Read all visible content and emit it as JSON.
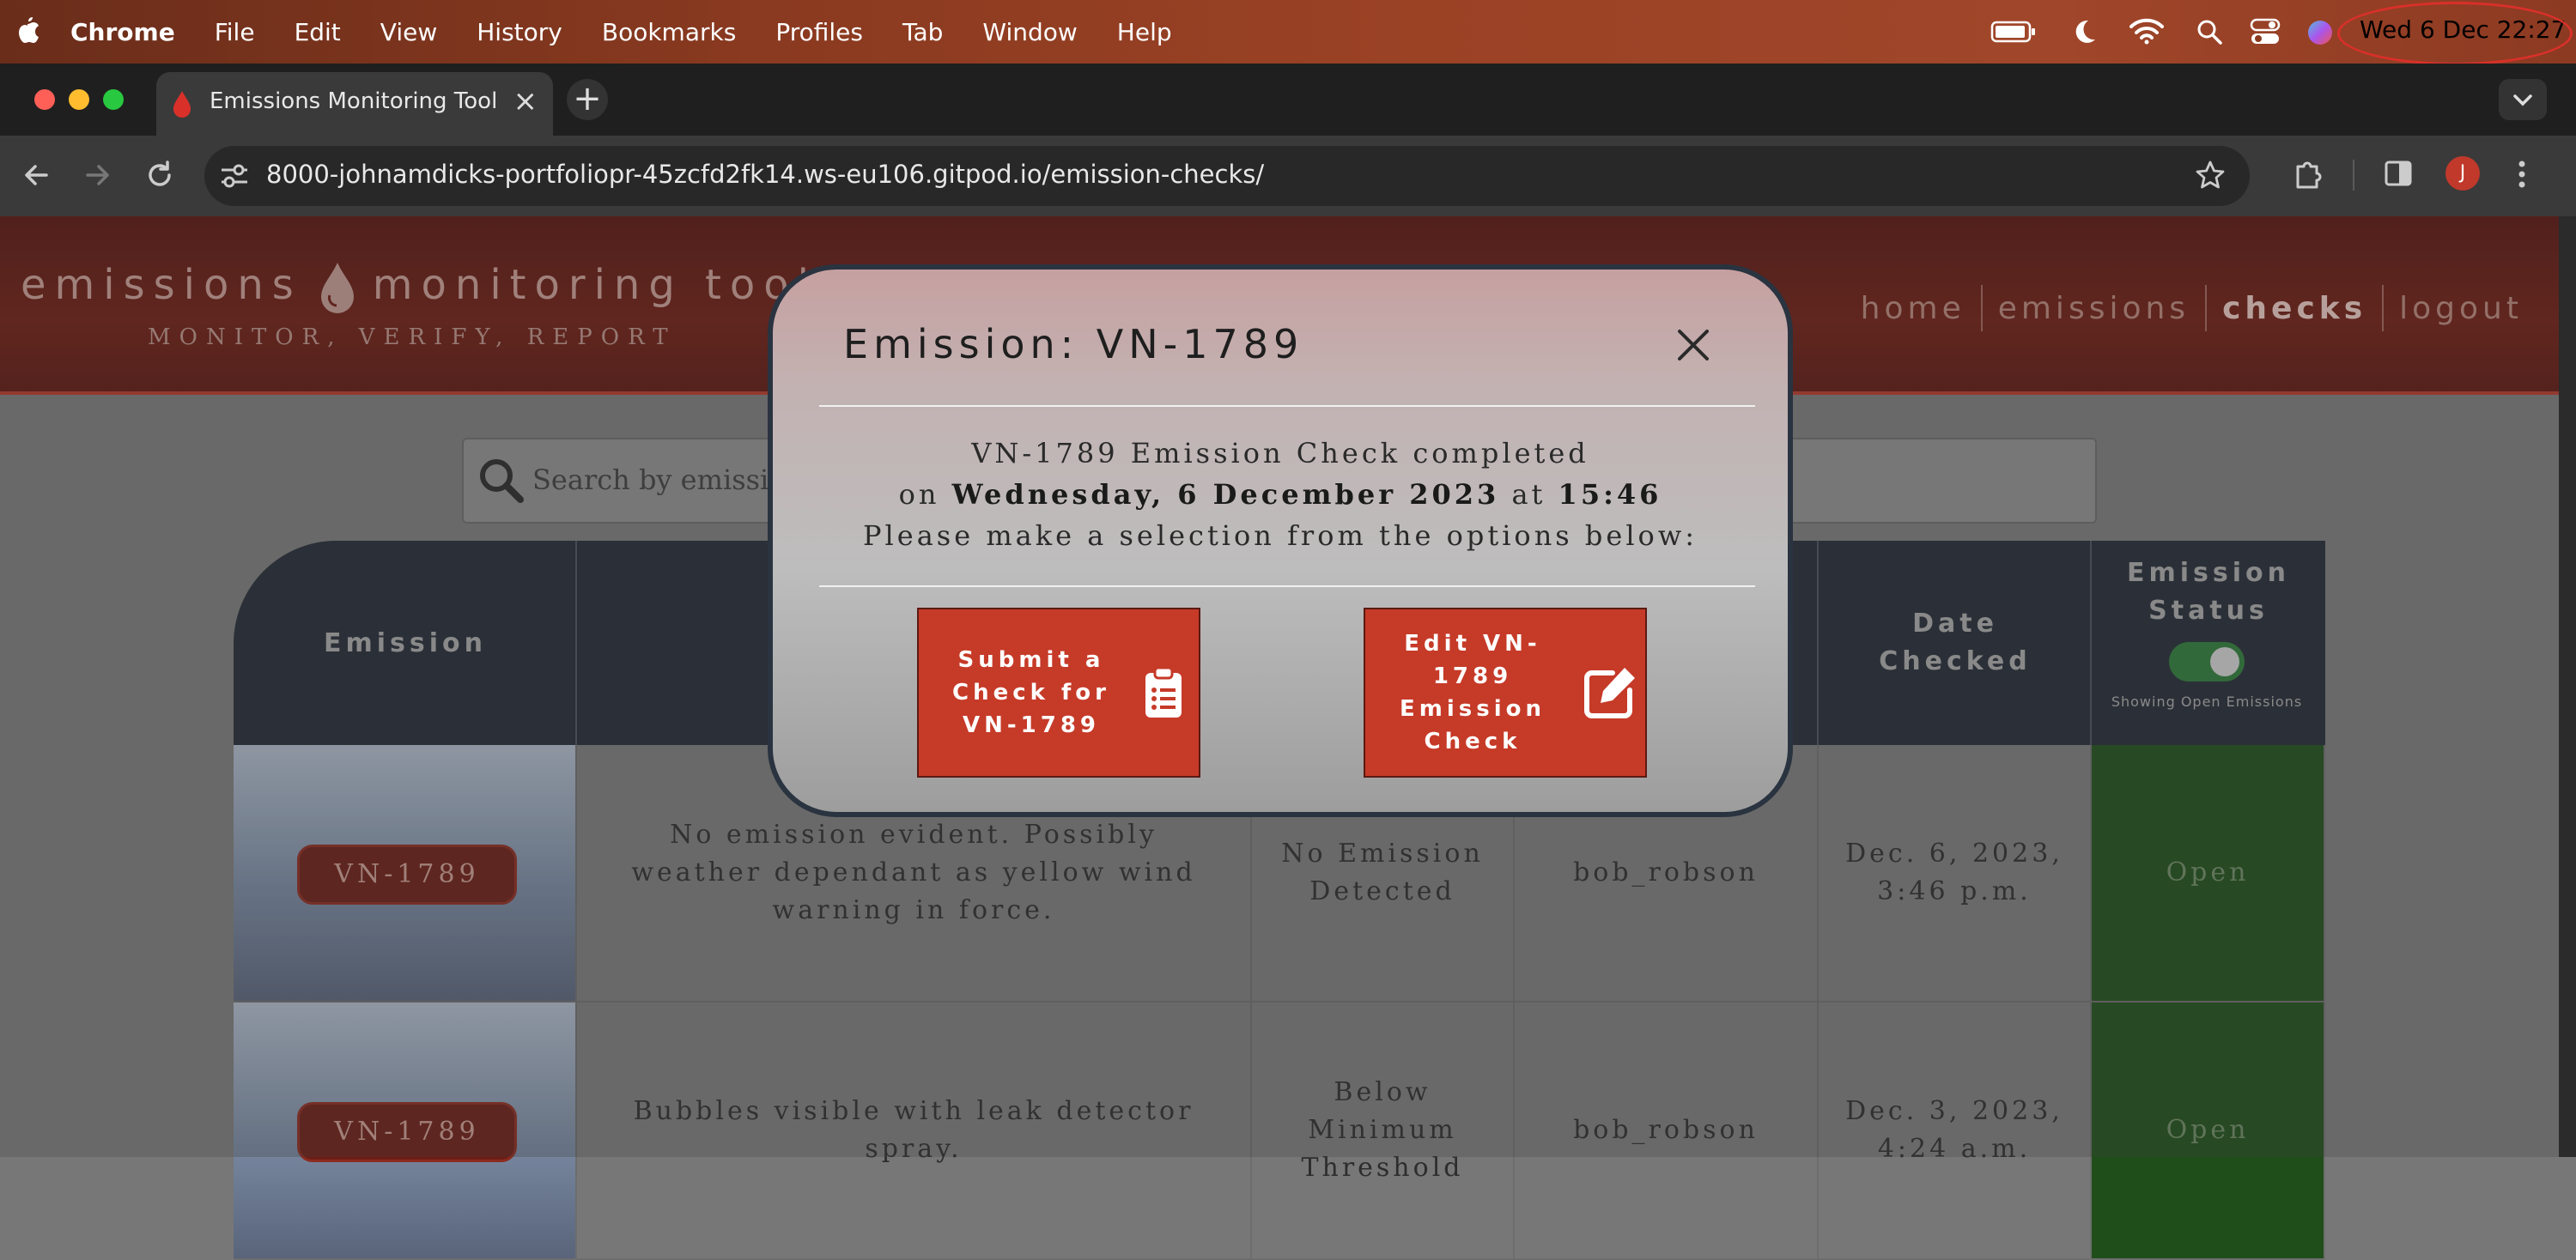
{
  "menubar": {
    "app": "Chrome",
    "items": [
      "File",
      "Edit",
      "View",
      "History",
      "Bookmarks",
      "Profiles",
      "Tab",
      "Window",
      "Help"
    ],
    "clock": "Wed 6 Dec  22:27"
  },
  "browser": {
    "tab_title": "Emissions Monitoring Tool",
    "url_host": "8000-johnamdicks-portfoliopr-45zcfd2fk14.ws-eu106.gitpod.io",
    "url_path": "/emission-checks/",
    "avatar_initial": "J"
  },
  "site": {
    "brand_left": "emissions",
    "brand_right": "monitoring tool",
    "tagline": "MONITOR, VERIFY, REPORT",
    "nav": [
      "home",
      "emissions",
      "checks",
      "logout"
    ],
    "active_nav": "checks",
    "search_placeholder": "Search by emission or"
  },
  "table": {
    "headers": {
      "emission": "Emission",
      "date_checked": "Date Checked",
      "status": "Emission Status"
    },
    "toggle_label": "Showing Open Emissions",
    "rows": [
      {
        "emission": "VN-1789",
        "notes": "No emission evident. Possibly weather dependant as yellow wind warning in force.",
        "result": "No Emission Detected",
        "user": "bob_robson",
        "date": "Dec. 6, 2023, 3:46 p.m.",
        "status": "Open"
      },
      {
        "emission": "VN-1789",
        "notes": "Bubbles visible with leak detector spray.",
        "result": "Below Minimum Threshold",
        "user": "bob_robson",
        "date": "Dec. 3, 2023, 4:24 a.m.",
        "status": "Open"
      }
    ]
  },
  "modal": {
    "title": "Emission: VN-1789",
    "line1": "VN-1789 Emission Check completed",
    "line2_prefix": "on ",
    "line2_date": "Wednesday, 6 December 2023",
    "line2_mid": " at ",
    "line2_time": "15:46",
    "line3": "Please make a selection from the options below:",
    "submit_button": "Submit a Check for VN-1789",
    "edit_button": "Edit VN-1789 Emission Check"
  },
  "colors": {
    "accent_red": "#c63a28",
    "header_red": "#6e1e14",
    "table_header": "#252c36",
    "status_green": "#1f4e1a"
  }
}
